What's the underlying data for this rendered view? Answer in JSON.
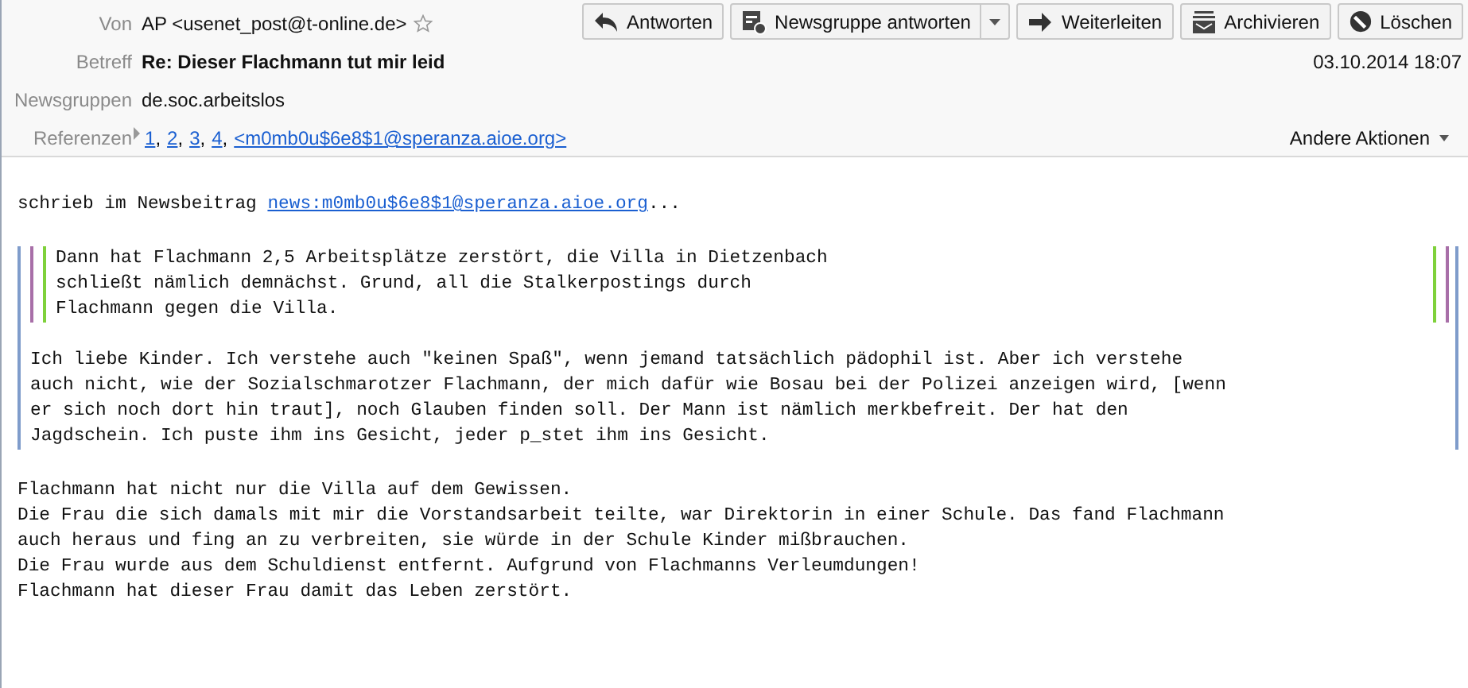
{
  "header": {
    "fields": [
      {
        "kind": "from",
        "label": "Von",
        "value": "AP <usenet_post@t-online.de>",
        "starred": false
      },
      {
        "kind": "subject",
        "label": "Betreff",
        "value": "Re: Dieser Flachmann tut mir leid",
        "date": "03.10.2014 18:07"
      },
      {
        "kind": "groups",
        "label": "Newsgruppen",
        "value": "de.soc.arbeitslos"
      },
      {
        "kind": "references",
        "label": "Referenzen",
        "expanded": false,
        "separator": ",",
        "links": [
          "1",
          "2",
          "3",
          "4",
          "<m0mb0u$6e8$1@speranza.aioe.org>"
        ]
      }
    ],
    "buttons": [
      {
        "kind": "reply",
        "label": "Antworten"
      },
      {
        "kind": "group-reply",
        "label": "Newsgruppe antworten",
        "dropdown": true
      },
      {
        "kind": "forward",
        "label": "Weiterleiten"
      },
      {
        "kind": "archive",
        "label": "Archivieren"
      },
      {
        "kind": "delete",
        "label": "Löschen"
      }
    ],
    "more_actions": "Andere Aktionen"
  },
  "body": [
    {
      "kind": "attribution",
      "text": "schrieb im Newsbeitrag ",
      "link": "news:m0mb0u$6e8$1@speranza.aioe.org",
      "suffix": "..."
    },
    {
      "kind": "quote",
      "children": [
        {
          "kind": "quote",
          "children": [
            {
              "kind": "quote",
              "children": [
                {
                  "kind": "text",
                  "text": "Dann hat Flachmann 2,5 Arbeitsplätze zerstört, die Villa in Dietzenbach\nschließt nämlich demnächst. Grund, all die Stalkerpostings durch\nFlachmann gegen die Villa."
                }
              ]
            }
          ]
        },
        {
          "kind": "text",
          "text": "Ich liebe Kinder. Ich verstehe auch \"keinen Spaß\", wenn jemand tatsächlich pädophil ist. Aber ich verstehe\nauch nicht, wie der Sozialschmarotzer Flachmann, der mich dafür wie Bosau bei der Polizei anzeigen wird, [wenn\ner sich noch dort hin traut], noch Glauben finden soll. Der Mann ist nämlich merkbefreit. Der hat den\nJagdschein. Ich puste ihm ins Gesicht, jeder p_stet ihm ins Gesicht."
        }
      ]
    },
    {
      "kind": "text",
      "text": "Flachmann hat nicht nur die Villa auf dem Gewissen.\nDie Frau die sich damals mit mir die Vorstandsarbeit teilte, war Direktorin in einer Schule. Das fand Flachmann\nauch heraus und fing an zu verbreiten, sie würde in der Schule Kinder mißbrauchen.\nDie Frau wurde aus dem Schuldienst entfernt. Aufgrund von Flachmanns Verleumdungen!\nFlachmann hat dieser Frau damit das Leben zerstört."
    }
  ]
}
